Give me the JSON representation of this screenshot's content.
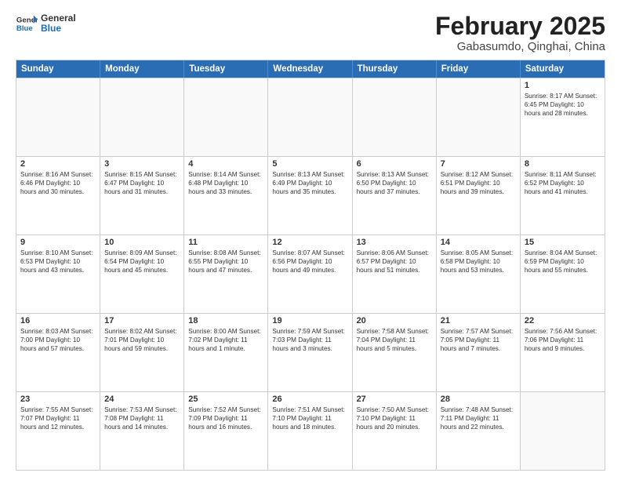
{
  "header": {
    "logo_general": "General",
    "logo_blue": "Blue",
    "title": "February 2025",
    "subtitle": "Gabasumdo, Qinghai, China"
  },
  "days_of_week": [
    "Sunday",
    "Monday",
    "Tuesday",
    "Wednesday",
    "Thursday",
    "Friday",
    "Saturday"
  ],
  "weeks": [
    [
      {
        "day": "",
        "info": ""
      },
      {
        "day": "",
        "info": ""
      },
      {
        "day": "",
        "info": ""
      },
      {
        "day": "",
        "info": ""
      },
      {
        "day": "",
        "info": ""
      },
      {
        "day": "",
        "info": ""
      },
      {
        "day": "1",
        "info": "Sunrise: 8:17 AM\nSunset: 6:45 PM\nDaylight: 10 hours and 28 minutes."
      }
    ],
    [
      {
        "day": "2",
        "info": "Sunrise: 8:16 AM\nSunset: 6:46 PM\nDaylight: 10 hours and 30 minutes."
      },
      {
        "day": "3",
        "info": "Sunrise: 8:15 AM\nSunset: 6:47 PM\nDaylight: 10 hours and 31 minutes."
      },
      {
        "day": "4",
        "info": "Sunrise: 8:14 AM\nSunset: 6:48 PM\nDaylight: 10 hours and 33 minutes."
      },
      {
        "day": "5",
        "info": "Sunrise: 8:13 AM\nSunset: 6:49 PM\nDaylight: 10 hours and 35 minutes."
      },
      {
        "day": "6",
        "info": "Sunrise: 8:13 AM\nSunset: 6:50 PM\nDaylight: 10 hours and 37 minutes."
      },
      {
        "day": "7",
        "info": "Sunrise: 8:12 AM\nSunset: 6:51 PM\nDaylight: 10 hours and 39 minutes."
      },
      {
        "day": "8",
        "info": "Sunrise: 8:11 AM\nSunset: 6:52 PM\nDaylight: 10 hours and 41 minutes."
      }
    ],
    [
      {
        "day": "9",
        "info": "Sunrise: 8:10 AM\nSunset: 6:53 PM\nDaylight: 10 hours and 43 minutes."
      },
      {
        "day": "10",
        "info": "Sunrise: 8:09 AM\nSunset: 6:54 PM\nDaylight: 10 hours and 45 minutes."
      },
      {
        "day": "11",
        "info": "Sunrise: 8:08 AM\nSunset: 6:55 PM\nDaylight: 10 hours and 47 minutes."
      },
      {
        "day": "12",
        "info": "Sunrise: 8:07 AM\nSunset: 6:56 PM\nDaylight: 10 hours and 49 minutes."
      },
      {
        "day": "13",
        "info": "Sunrise: 8:06 AM\nSunset: 6:57 PM\nDaylight: 10 hours and 51 minutes."
      },
      {
        "day": "14",
        "info": "Sunrise: 8:05 AM\nSunset: 6:58 PM\nDaylight: 10 hours and 53 minutes."
      },
      {
        "day": "15",
        "info": "Sunrise: 8:04 AM\nSunset: 6:59 PM\nDaylight: 10 hours and 55 minutes."
      }
    ],
    [
      {
        "day": "16",
        "info": "Sunrise: 8:03 AM\nSunset: 7:00 PM\nDaylight: 10 hours and 57 minutes."
      },
      {
        "day": "17",
        "info": "Sunrise: 8:02 AM\nSunset: 7:01 PM\nDaylight: 10 hours and 59 minutes."
      },
      {
        "day": "18",
        "info": "Sunrise: 8:00 AM\nSunset: 7:02 PM\nDaylight: 11 hours and 1 minute."
      },
      {
        "day": "19",
        "info": "Sunrise: 7:59 AM\nSunset: 7:03 PM\nDaylight: 11 hours and 3 minutes."
      },
      {
        "day": "20",
        "info": "Sunrise: 7:58 AM\nSunset: 7:04 PM\nDaylight: 11 hours and 5 minutes."
      },
      {
        "day": "21",
        "info": "Sunrise: 7:57 AM\nSunset: 7:05 PM\nDaylight: 11 hours and 7 minutes."
      },
      {
        "day": "22",
        "info": "Sunrise: 7:56 AM\nSunset: 7:06 PM\nDaylight: 11 hours and 9 minutes."
      }
    ],
    [
      {
        "day": "23",
        "info": "Sunrise: 7:55 AM\nSunset: 7:07 PM\nDaylight: 11 hours and 12 minutes."
      },
      {
        "day": "24",
        "info": "Sunrise: 7:53 AM\nSunset: 7:08 PM\nDaylight: 11 hours and 14 minutes."
      },
      {
        "day": "25",
        "info": "Sunrise: 7:52 AM\nSunset: 7:09 PM\nDaylight: 11 hours and 16 minutes."
      },
      {
        "day": "26",
        "info": "Sunrise: 7:51 AM\nSunset: 7:10 PM\nDaylight: 11 hours and 18 minutes."
      },
      {
        "day": "27",
        "info": "Sunrise: 7:50 AM\nSunset: 7:10 PM\nDaylight: 11 hours and 20 minutes."
      },
      {
        "day": "28",
        "info": "Sunrise: 7:48 AM\nSunset: 7:11 PM\nDaylight: 11 hours and 22 minutes."
      },
      {
        "day": "",
        "info": ""
      }
    ]
  ]
}
